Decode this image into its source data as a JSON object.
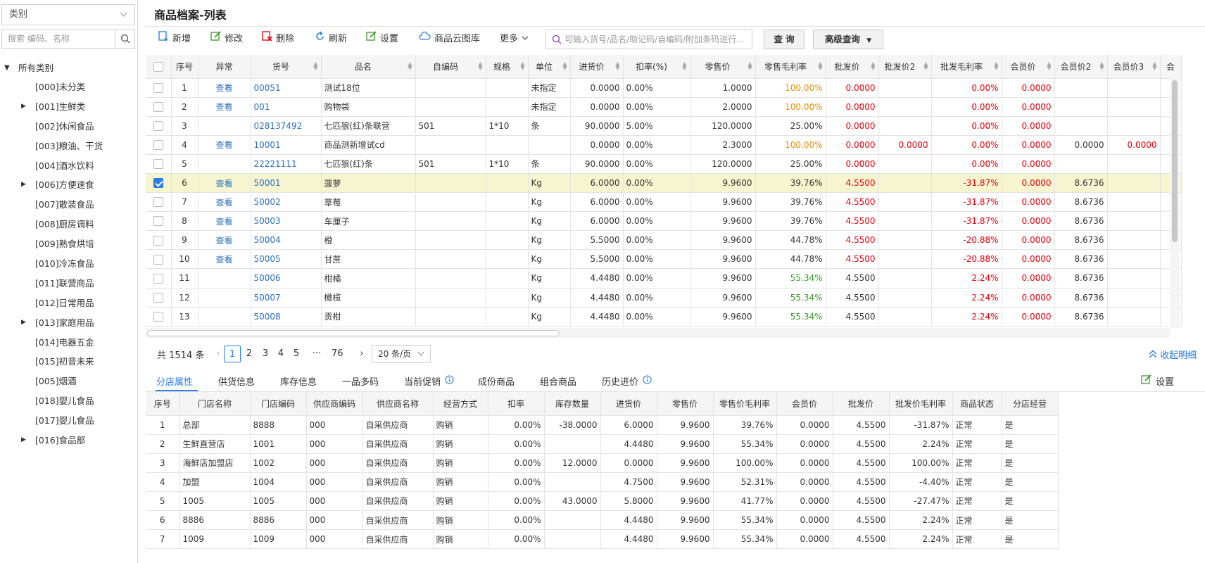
{
  "sidebar": {
    "category_select": "类别",
    "search_placeholder": "搜索 编码、名称",
    "root": "所有类别",
    "items": [
      {
        "label": "[000]未分类",
        "expandable": false
      },
      {
        "label": "[001]生鲜类",
        "expandable": true
      },
      {
        "label": "[002]休闲食品",
        "expandable": false
      },
      {
        "label": "[003]粮油、干货",
        "expandable": false
      },
      {
        "label": "[004]酒水饮料",
        "expandable": false
      },
      {
        "label": "[006]方便速食",
        "expandable": true
      },
      {
        "label": "[007]散装食品",
        "expandable": false
      },
      {
        "label": "[008]厨房调料",
        "expandable": false
      },
      {
        "label": "[009]熟食烘培",
        "expandable": false
      },
      {
        "label": "[010]冷冻食品",
        "expandable": false
      },
      {
        "label": "[011]联营商品",
        "expandable": false
      },
      {
        "label": "[012]日常用品",
        "expandable": false
      },
      {
        "label": "[013]家庭用品",
        "expandable": true
      },
      {
        "label": "[014]电器五金",
        "expandable": false
      },
      {
        "label": "[015]初音未来",
        "expandable": false
      },
      {
        "label": "[005]烟酒",
        "expandable": false
      },
      {
        "label": "[018]婴儿食品",
        "expandable": false
      },
      {
        "label": "[017]婴儿食品",
        "expandable": false
      },
      {
        "label": "[016]食品部",
        "expandable": true
      }
    ]
  },
  "page": {
    "title": "商品档案-列表"
  },
  "toolbar": {
    "add": "新增",
    "edit": "修改",
    "delete": "删除",
    "refresh": "刷新",
    "settings": "设置",
    "cloud_gallery": "商品云图库",
    "more": "更多",
    "search_placeholder": "可输入货号/品名/助记码/自编码/附加条码进行...",
    "query": "查 询",
    "advanced": "高级查询"
  },
  "grid": {
    "columns": [
      "序号",
      "异常",
      "货号",
      "品名",
      "自编码",
      "规格",
      "单位",
      "进货价",
      "扣率(%)",
      "零售价",
      "零售毛利率",
      "批发价",
      "批发价2",
      "批发毛利率",
      "会员价",
      "会员价2",
      "会员价3",
      "会"
    ],
    "rows": [
      {
        "no": "1",
        "view": "查看",
        "code": "00051",
        "name": "测试18位",
        "selfcode": "",
        "spec": "",
        "unit": "未指定",
        "cost": "0.0000",
        "discount": "0.00%",
        "retail": "1.0000",
        "retail_margin": "100.00%",
        "retail_margin_color": "orange",
        "wholesale": "0.0000",
        "wholesale_color": "red",
        "wholesale2": "",
        "wholesale_margin": "0.00%",
        "member": "0.0000",
        "member2": "",
        "member3": "",
        "checked": false
      },
      {
        "no": "2",
        "view": "查看",
        "code": "001",
        "name": "购物袋",
        "selfcode": "",
        "spec": "",
        "unit": "未指定",
        "cost": "0.0000",
        "discount": "0.00%",
        "retail": "2.0000",
        "retail_margin": "100.00%",
        "retail_margin_color": "orange",
        "wholesale": "0.0000",
        "wholesale_color": "red",
        "wholesale2": "",
        "wholesale_margin": "0.00%",
        "member": "0.0000",
        "member2": "",
        "member3": "",
        "checked": false
      },
      {
        "no": "3",
        "view": "",
        "code": "028137492",
        "name": "七匹狼(红)条联营",
        "selfcode": "501",
        "spec": "1*10",
        "unit": "条",
        "cost": "90.0000",
        "discount": "5.00%",
        "retail": "120.0000",
        "retail_margin": "25.00%",
        "retail_margin_color": "",
        "wholesale": "0.0000",
        "wholesale_color": "red",
        "wholesale2": "",
        "wholesale_margin": "0.00%",
        "member": "0.0000",
        "member2": "",
        "member3": "",
        "checked": false
      },
      {
        "no": "4",
        "view": "查看",
        "code": "10001",
        "name": "商品测新增试cd",
        "selfcode": "",
        "spec": "",
        "unit": "",
        "cost": "0.0000",
        "discount": "0.00%",
        "retail": "2.3000",
        "retail_margin": "100.00%",
        "retail_margin_color": "orange",
        "wholesale": "0.0000",
        "wholesale_color": "red",
        "wholesale2": "0.0000",
        "wholesale_margin": "0.00%",
        "member": "0.0000",
        "member2": "0.0000",
        "member3": "0.0000",
        "checked": false
      },
      {
        "no": "5",
        "view": "",
        "code": "22221111",
        "name": "七匹狼(红)条",
        "selfcode": "501",
        "spec": "1*10",
        "unit": "条",
        "cost": "90.0000",
        "discount": "0.00%",
        "retail": "120.0000",
        "retail_margin": "25.00%",
        "retail_margin_color": "",
        "wholesale": "0.0000",
        "wholesale_color": "red",
        "wholesale2": "",
        "wholesale_margin": "0.00%",
        "member": "0.0000",
        "member2": "",
        "member3": "",
        "checked": false
      },
      {
        "no": "6",
        "view": "查看",
        "code": "50001",
        "name": "菠萝",
        "selfcode": "",
        "spec": "",
        "unit": "Kg",
        "cost": "6.0000",
        "discount": "0.00%",
        "retail": "9.9600",
        "retail_margin": "39.76%",
        "retail_margin_color": "",
        "wholesale": "4.5500",
        "wholesale_color": "red",
        "wholesale2": "",
        "wholesale_margin": "-31.87%",
        "member": "0.0000",
        "member2": "8.6736",
        "member3": "",
        "checked": true
      },
      {
        "no": "7",
        "view": "查看",
        "code": "50002",
        "name": "草莓",
        "selfcode": "",
        "spec": "",
        "unit": "Kg",
        "cost": "6.0000",
        "discount": "0.00%",
        "retail": "9.9600",
        "retail_margin": "39.76%",
        "retail_margin_color": "",
        "wholesale": "4.5500",
        "wholesale_color": "red",
        "wholesale2": "",
        "wholesale_margin": "-31.87%",
        "member": "0.0000",
        "member2": "8.6736",
        "member3": "",
        "checked": false
      },
      {
        "no": "8",
        "view": "查看",
        "code": "50003",
        "name": "车厘子",
        "selfcode": "",
        "spec": "",
        "unit": "Kg",
        "cost": "6.0000",
        "discount": "0.00%",
        "retail": "9.9600",
        "retail_margin": "39.76%",
        "retail_margin_color": "",
        "wholesale": "4.5500",
        "wholesale_color": "red",
        "wholesale2": "",
        "wholesale_margin": "-31.87%",
        "member": "0.0000",
        "member2": "8.6736",
        "member3": "",
        "checked": false
      },
      {
        "no": "9",
        "view": "查看",
        "code": "50004",
        "name": "橙",
        "selfcode": "",
        "spec": "",
        "unit": "Kg",
        "cost": "5.5000",
        "discount": "0.00%",
        "retail": "9.9600",
        "retail_margin": "44.78%",
        "retail_margin_color": "",
        "wholesale": "4.5500",
        "wholesale_color": "red",
        "wholesale2": "",
        "wholesale_margin": "-20.88%",
        "member": "0.0000",
        "member2": "8.6736",
        "member3": "",
        "checked": false
      },
      {
        "no": "10",
        "view": "查看",
        "code": "50005",
        "name": "甘蔗",
        "selfcode": "",
        "spec": "",
        "unit": "Kg",
        "cost": "5.5000",
        "discount": "0.00%",
        "retail": "9.9600",
        "retail_margin": "44.78%",
        "retail_margin_color": "",
        "wholesale": "4.5500",
        "wholesale_color": "red",
        "wholesale2": "",
        "wholesale_margin": "-20.88%",
        "member": "0.0000",
        "member2": "8.6736",
        "member3": "",
        "checked": false
      },
      {
        "no": "11",
        "view": "",
        "code": "50006",
        "name": "柑橘",
        "selfcode": "",
        "spec": "",
        "unit": "Kg",
        "cost": "4.4480",
        "discount": "0.00%",
        "retail": "9.9600",
        "retail_margin": "55.34%",
        "retail_margin_color": "green",
        "wholesale": "4.5500",
        "wholesale_color": "",
        "wholesale2": "",
        "wholesale_margin": "2.24%",
        "member": "0.0000",
        "member2": "8.6736",
        "member3": "",
        "checked": false
      },
      {
        "no": "12",
        "view": "",
        "code": "50007",
        "name": "橄榄",
        "selfcode": "",
        "spec": "",
        "unit": "Kg",
        "cost": "4.4480",
        "discount": "0.00%",
        "retail": "9.9600",
        "retail_margin": "55.34%",
        "retail_margin_color": "green",
        "wholesale": "4.5500",
        "wholesale_color": "",
        "wholesale2": "",
        "wholesale_margin": "2.24%",
        "member": "0.0000",
        "member2": "8.6736",
        "member3": "",
        "checked": false
      },
      {
        "no": "13",
        "view": "",
        "code": "50008",
        "name": "贡柑",
        "selfcode": "",
        "spec": "",
        "unit": "Kg",
        "cost": "4.4480",
        "discount": "0.00%",
        "retail": "9.9600",
        "retail_margin": "55.34%",
        "retail_margin_color": "green",
        "wholesale": "4.5500",
        "wholesale_color": "",
        "wholesale2": "",
        "wholesale_margin": "2.24%",
        "member": "0.0000",
        "member2": "8.6736",
        "member3": "",
        "checked": false
      }
    ]
  },
  "pager": {
    "total": "共 1514 条",
    "pages": [
      "1",
      "2",
      "3",
      "4",
      "5",
      "···",
      "76"
    ],
    "page_size": "20 条/页",
    "collapse": "收起明细"
  },
  "tabs": {
    "items": [
      "分店属性",
      "供货信息",
      "库存信息",
      "一品多码",
      "当前促销",
      "成份商品",
      "组合商品",
      "历史进价"
    ],
    "settings": "设置"
  },
  "detail": {
    "columns": [
      "序号",
      "门店名称",
      "门店编码",
      "供应商编码",
      "供应商名称",
      "经营方式",
      "扣率",
      "库存数量",
      "进货价",
      "零售价",
      "零售价毛利率",
      "会员价",
      "批发价",
      "批发价毛利率",
      "商品状态",
      "分店经营"
    ],
    "rows": [
      {
        "no": "1",
        "store": "总部",
        "store_code": "8888",
        "sup_code": "000",
        "sup_name": "自采供应商",
        "mode": "购销",
        "discount": "0.00%",
        "stock": "-38.0000",
        "cost": "6.0000",
        "retail": "9.9600",
        "retail_margin": "39.76%",
        "member": "0.0000",
        "wholesale": "4.5500",
        "wholesale_margin": "-31.87%",
        "status": "正常",
        "branch": "是"
      },
      {
        "no": "2",
        "store": "生鲜直营店",
        "store_code": "1001",
        "sup_code": "000",
        "sup_name": "自采供应商",
        "mode": "购销",
        "discount": "0.00%",
        "stock": "",
        "cost": "4.4480",
        "retail": "9.9600",
        "retail_margin": "55.34%",
        "member": "0.0000",
        "wholesale": "4.5500",
        "wholesale_margin": "2.24%",
        "status": "正常",
        "branch": "是"
      },
      {
        "no": "3",
        "store": "海鲜店加盟店",
        "store_code": "1002",
        "sup_code": "000",
        "sup_name": "自采供应商",
        "mode": "购销",
        "discount": "0.00%",
        "stock": "12.0000",
        "cost": "0.0000",
        "retail": "9.9600",
        "retail_margin": "100.00%",
        "member": "0.0000",
        "wholesale": "4.5500",
        "wholesale_margin": "100.00%",
        "status": "正常",
        "branch": "是"
      },
      {
        "no": "4",
        "store": "加盟",
        "store_code": "1004",
        "sup_code": "000",
        "sup_name": "自采供应商",
        "mode": "购销",
        "discount": "0.00%",
        "stock": "",
        "cost": "4.7500",
        "retail": "9.9600",
        "retail_margin": "52.31%",
        "member": "0.0000",
        "wholesale": "4.5500",
        "wholesale_margin": "-4.40%",
        "status": "正常",
        "branch": "是"
      },
      {
        "no": "5",
        "store": "1005",
        "store_code": "1005",
        "sup_code": "000",
        "sup_name": "自采供应商",
        "mode": "购销",
        "discount": "0.00%",
        "stock": "43.0000",
        "cost": "5.8000",
        "retail": "9.9600",
        "retail_margin": "41.77%",
        "member": "0.0000",
        "wholesale": "4.5500",
        "wholesale_margin": "-27.47%",
        "status": "正常",
        "branch": "是"
      },
      {
        "no": "6",
        "store": "8886",
        "store_code": "8886",
        "sup_code": "000",
        "sup_name": "自采供应商",
        "mode": "购销",
        "discount": "0.00%",
        "stock": "",
        "cost": "4.4480",
        "retail": "9.9600",
        "retail_margin": "55.34%",
        "member": "0.0000",
        "wholesale": "4.5500",
        "wholesale_margin": "2.24%",
        "status": "正常",
        "branch": "是"
      },
      {
        "no": "7",
        "store": "1009",
        "store_code": "1009",
        "sup_code": "000",
        "sup_name": "自采供应商",
        "mode": "购销",
        "discount": "0.00%",
        "stock": "",
        "cost": "4.4480",
        "retail": "9.9600",
        "retail_margin": "55.34%",
        "member": "0.0000",
        "wholesale": "4.5500",
        "wholesale_margin": "2.24%",
        "status": "正常",
        "branch": "是"
      }
    ]
  },
  "colors": {
    "accent": "#2a7de1",
    "link": "#2a6ebd",
    "red": "#e8000b",
    "orange": "#f08c00",
    "green": "#3a9a2a",
    "selected_row": "#f7f5d0"
  }
}
